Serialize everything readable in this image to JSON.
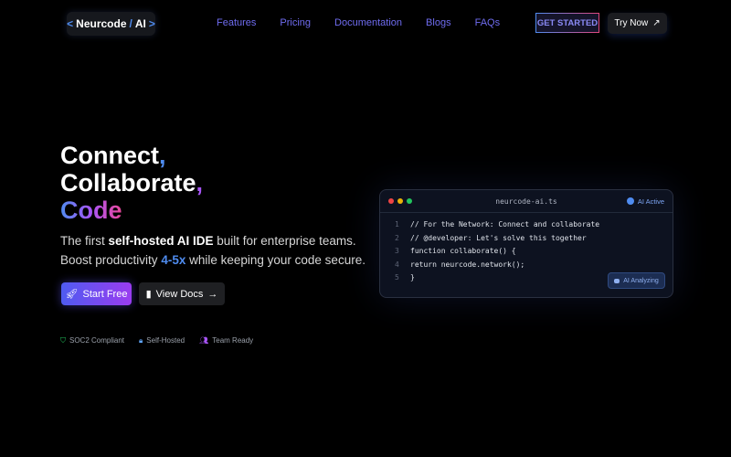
{
  "header": {
    "logo": {
      "lt": "<",
      "name": "Neurcode",
      "slash": "/",
      "ai": "AI",
      "gt": ">"
    },
    "nav": [
      "Features",
      "Pricing",
      "Documentation",
      "Blogs",
      "FAQs"
    ],
    "get_started": "GET STARTED",
    "try_now": "Try Now"
  },
  "hero": {
    "line1": "Connect",
    "line2": "Collaborate",
    "line3": "Code",
    "comma": ",",
    "sub1_pre": "The first ",
    "sub1_bold": "self-hosted AI IDE",
    "sub1_post": " built for enterprise teams.",
    "sub2_pre": "Boost productivity ",
    "sub2_hl": "4-5x",
    "sub2_post": " while keeping your code secure.",
    "start_free": "Start Free",
    "view_docs": "View Docs",
    "badges": [
      "SOC2 Compliant",
      "Self-Hosted",
      "Team Ready"
    ]
  },
  "editor": {
    "filename": "neurcode-ai.ts",
    "status": "AI Active",
    "analyzing": "AI Analyzing",
    "lines": [
      {
        "n": "1",
        "t": "// For the Network: Connect and collaborate"
      },
      {
        "n": "2",
        "t": "// @developer: Let's solve this together"
      },
      {
        "n": "3",
        "t": "function collaborate() {"
      },
      {
        "n": "4",
        "t": "return neurcode.network();"
      },
      {
        "n": "5",
        "t": "}"
      }
    ]
  }
}
